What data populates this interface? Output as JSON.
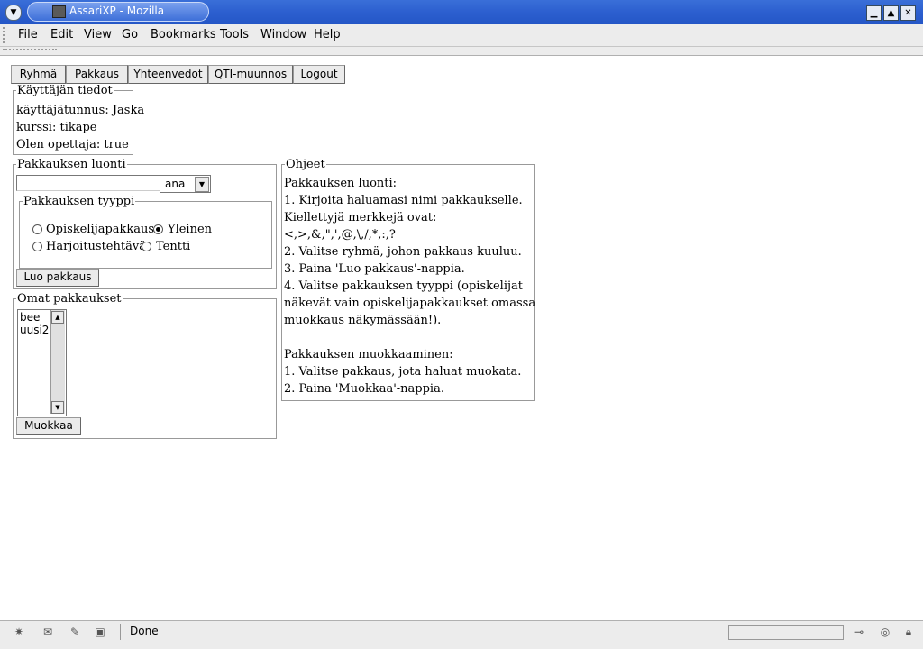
{
  "window": {
    "title": "AssariXP - Mozilla",
    "menu_icon": "dropdown-arrow-icon",
    "controls": [
      "minimize-icon",
      "maximize-icon",
      "close-icon"
    ]
  },
  "menubar": {
    "items": [
      "File",
      "Edit",
      "View",
      "Go",
      "Bookmarks",
      "Tools",
      "Window",
      "Help"
    ]
  },
  "nav": {
    "buttons": [
      "Ryhmä",
      "Pakkaus",
      "Yhteenvedot",
      "QTI-muunnos",
      "Logout"
    ]
  },
  "user_info": {
    "legend": "Käyttäjän tiedot",
    "username_line": "käyttäjätunnus: Jaska",
    "course_line": "kurssi: tikape",
    "teacher_line": "Olen opettaja: true"
  },
  "create_package": {
    "legend": "Pakkauksen luonti",
    "name_value": "",
    "group_select_value": "ana",
    "type_legend": "Pakkauksen tyyppi",
    "types": [
      {
        "label": "Opiskelijapakkaus",
        "checked": false
      },
      {
        "label": "Yleinen",
        "checked": true
      },
      {
        "label": "Harjoitustehtävä",
        "checked": false
      },
      {
        "label": "Tentti",
        "checked": false
      }
    ],
    "create_button": "Luo pakkaus"
  },
  "own_packages": {
    "legend": "Omat pakkaukset",
    "items": [
      "bee",
      "uusi2"
    ],
    "edit_button": "Muokkaa"
  },
  "instructions": {
    "legend": "Ohjeet",
    "lines": [
      "Pakkauksen luonti:",
      "1. Kirjoita haluamasi nimi pakkaukselle.",
      "Kiellettyjä merkkejä ovat:",
      "<,>,&,\",',@,\\,/,*,:,?",
      "2. Valitse ryhmä, johon pakkaus kuuluu.",
      "3. Paina 'Luo pakkaus'-nappia.",
      "4. Valitse pakkauksen tyyppi (opiskelijat",
      "näkevät vain opiskelijapakkaukset omassa",
      "muokkaus näkymässään!).",
      "",
      "Pakkauksen muokkaaminen:",
      "1. Valitse pakkaus, jota haluat muokata.",
      "2. Paina 'Muokkaa'-nappia."
    ]
  },
  "statusbar": {
    "status": "Done",
    "icons": [
      "navigator-icon",
      "mail-icon",
      "composer-icon",
      "address-book-icon",
      "connection-icon",
      "security-icon",
      "lock-icon"
    ]
  }
}
